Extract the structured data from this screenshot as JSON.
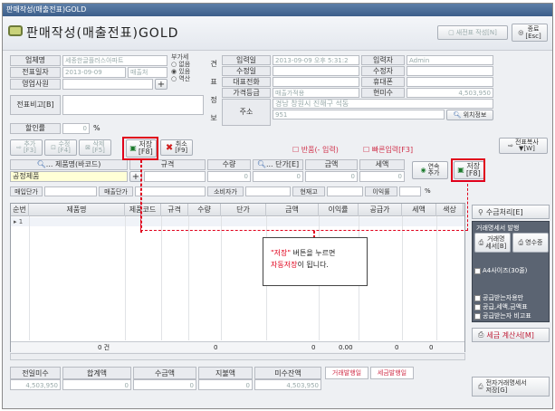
{
  "window": {
    "title": "판매작성(매출전표)GOLD"
  },
  "header": {
    "title": "판매작성(매출전표)GOLD",
    "new_btn": "새전표 작성[N]",
    "exit_btn": "종료\n[Esc]"
  },
  "form": {
    "company_label": "업체명",
    "company_value": "세종한글플러스아파트",
    "vat_label": "부가세",
    "vat_options": [
      "없음",
      "있음",
      "역산"
    ],
    "date_label": "전표일자",
    "date_value": "2013-09-09",
    "date_type": "매출처",
    "sales_label": "영업사원",
    "plus": "+",
    "memo_label": "전표비고[B]",
    "discount_label": "할인률",
    "discount_value": "0",
    "discount_unit": "%",
    "side_labels": [
      "견",
      "표",
      "정",
      "보"
    ],
    "input_date_label": "입력일",
    "input_date_value": "2013-09-09 오후 5:31:2",
    "inputter_label": "입력자",
    "inputter_value": "Admin",
    "modify_date_label": "수정일",
    "modifier_label": "수정자",
    "rep_phone_label": "대표전화",
    "mobile_label": "휴대폰",
    "price_grade_label": "가격등급",
    "price_grade_value": "매출가적용",
    "current_due_label": "현미수",
    "current_due_value": "4,503,950",
    "address_label": "주소",
    "address_value": "경남 창원시 진해구 석동",
    "address_zip": "951",
    "location_btn": "위치정보"
  },
  "toolbar": {
    "add": "추가\n[F3]",
    "edit": "수정\n[F4]",
    "del": "삭제\n[F5]",
    "save": "저장\n[F8]",
    "cancel": "취소\n[F9]",
    "return_opt": "반품(- 입력)",
    "quick_opt": "빠른입력[F3]",
    "copy_btn": "전표복사\n▼[W]"
  },
  "entry": {
    "product_label": "... 제품명(바코드)",
    "spec_label": "규격",
    "qty_label": "수량",
    "price_label": "... 단가[E]",
    "amount_label": "금액",
    "tax_label": "세액",
    "product_value": "공정제품",
    "qty_value": "0",
    "price_value": "0",
    "amount_value": "0",
    "tax_value": "0",
    "continuous": "연속\n추가",
    "save2": "저장\n[F8]",
    "buy_price": "매입단가",
    "sell_price": "매출단가",
    "consumer_price": "소비자가",
    "stock": "현재고",
    "margin": "이익률",
    "margin_unit": "%"
  },
  "grid": {
    "columns": [
      "순번",
      "제품명",
      "제품코드",
      "규격",
      "수량",
      "단가",
      "금액",
      "이익률",
      "공급가",
      "세액",
      "색상"
    ],
    "row_marker": "▸ 1",
    "summary": {
      "count": "0 건",
      "qty": "0",
      "amount": "0",
      "margin": "0.00",
      "supply": "0",
      "tax": "0"
    }
  },
  "side": {
    "collect_btn": "수금처리[E]",
    "issue_header": "거래명세서 발행",
    "statement_btn": "거래명\n세서[B]",
    "receipt_btn": "영수증",
    "a4": "A4사이즈(30줄)",
    "opt1": "공급받는자용만",
    "opt2": "공급,세액,금액표",
    "opt3": "공급받는자 비고표",
    "tax_invoice_btn": "세금 계산서[M]",
    "e_statement_btn": "전자거래명세서\n저장[G]"
  },
  "bottom": {
    "labels": [
      "전일미수",
      "합계액",
      "수금액",
      "지불액",
      "미수잔액"
    ],
    "values": [
      "4,503,950",
      "0",
      "0",
      "0",
      "4,503,950"
    ],
    "tag1": "거래발행일",
    "tag2": "세금발행일"
  },
  "callout": {
    "highlight": "\"저장\"",
    "line1_rest": " 버튼을 누르면",
    "highlight2": "자동저장",
    "line2_rest": "이 됩니다."
  }
}
